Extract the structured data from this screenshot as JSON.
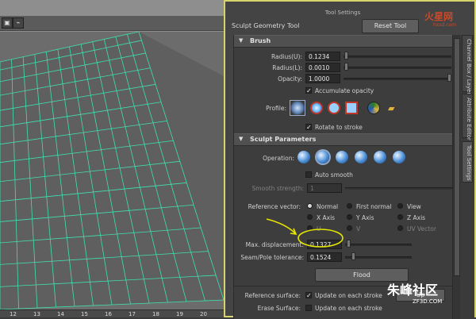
{
  "viewport": {
    "ruler_ticks": [
      "12",
      "13",
      "14",
      "15",
      "16",
      "17",
      "18",
      "19",
      "20"
    ]
  },
  "panel": {
    "header_title": "Tool Settings",
    "tool_name": "Sculpt Geometry Tool",
    "reset_label": "Reset Tool",
    "tabs": [
      "Channel Box / Layer Editor",
      "Attribute Editor",
      "Tool Settings"
    ]
  },
  "brush": {
    "section_title": "Brush",
    "radius_u_label": "Radius(U):",
    "radius_u_value": "0.1234",
    "radius_u_level": 0.01,
    "radius_l_label": "Radius(L):",
    "radius_l_value": "0.0010",
    "radius_l_level": 0.01,
    "opacity_label": "Opacity:",
    "opacity_value": "1.0000",
    "opacity_level": 1.0,
    "accumulate_label": "Accumulate opacity",
    "accumulate_checked": true,
    "profile_label": "Profile:",
    "rotate_label": "Rotate to stroke",
    "rotate_checked": true
  },
  "sculpt": {
    "section_title": "Sculpt Parameters",
    "operation_label": "Operation:",
    "auto_smooth_label": "Auto smooth",
    "auto_smooth_checked": false,
    "smooth_strength_label": "Smooth strength:",
    "smooth_strength_value": "1",
    "ref_vector_label": "Reference vector:",
    "ref_options": [
      "Normal",
      "First normal",
      "View",
      "X Axis",
      "Y Axis",
      "Z Axis",
      "U",
      "V",
      "UV Vector"
    ],
    "ref_selected": "Normal",
    "max_disp_label": "Max. displacement:",
    "max_disp_value": "0.1327",
    "max_disp_level": 0.02,
    "seam_label": "Seam/Pole tolerance:",
    "seam_value": "0.1524",
    "seam_level": 0.1,
    "flood_label": "Flood",
    "ref_surface_label": "Reference surface:",
    "update_stroke_label": "Update on each stroke",
    "update_stroke_checked": true,
    "erase_surface_label": "Erase Surface:",
    "erase_update_label": "Update on each stroke",
    "up_label": "Up"
  },
  "watermarks": {
    "top_logo": "火星网",
    "top_url": "hxsd.com",
    "bottom_logo": "朱峰社区",
    "bottom_url": "ZF3D.COM"
  },
  "colors": {
    "grid_line": "#3fe0b0",
    "panel_highlight": "#d4d46a",
    "annotation": "#e6e600"
  }
}
